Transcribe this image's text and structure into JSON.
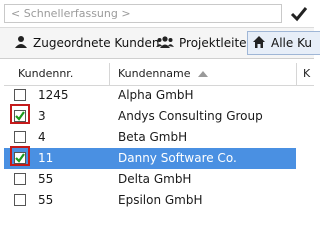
{
  "quick_search": {
    "placeholder": "< Schnellerfassung >"
  },
  "tabs": [
    {
      "label": "Zugeordnete Kunden",
      "icon": "single-user-icon"
    },
    {
      "label": "Projektleiter",
      "icon": "user-group-icon"
    },
    {
      "label": "Alle Ku",
      "icon": "home-icon"
    }
  ],
  "table": {
    "columns": [
      "Kundennr.",
      "Kundenname",
      "K"
    ],
    "sorted_column": "Kundenname",
    "sort_direction": "ascending",
    "rows": [
      {
        "nr": "1245",
        "name": "Alpha GmbH",
        "checked": false,
        "selected": false
      },
      {
        "nr": "3",
        "name": "Andys Consulting Group",
        "checked": true,
        "selected": false
      },
      {
        "nr": "4",
        "name": "Beta GmbH",
        "checked": false,
        "selected": false
      },
      {
        "nr": "11",
        "name": "Danny Software Co.",
        "checked": true,
        "selected": true
      },
      {
        "nr": "55",
        "name": "Delta GmbH",
        "checked": false,
        "selected": false
      },
      {
        "nr": "55",
        "name": "Epsilon GmbH",
        "checked": false,
        "selected": false
      }
    ]
  },
  "colors": {
    "selection": "#4a90e2",
    "highlight_box": "#c41a1a",
    "active_tab_bg": "#e7eef8"
  }
}
